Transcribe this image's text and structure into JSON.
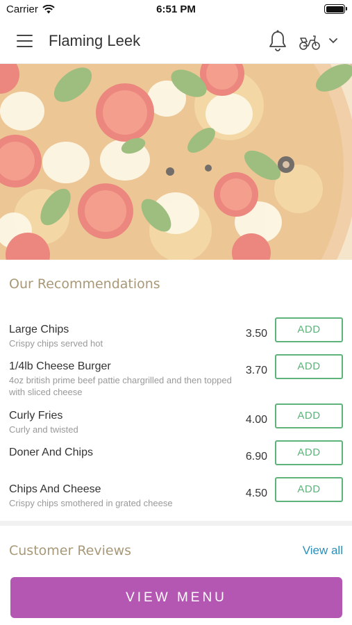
{
  "status_bar": {
    "carrier": "Carrier",
    "time": "6:51 PM"
  },
  "header": {
    "title": "Flaming Leek"
  },
  "icons": {
    "menu": "hamburger-icon",
    "notifications": "bell-icon",
    "delivery": "scooter-icon",
    "dropdown": "chevron-down-icon"
  },
  "recommendations": {
    "title": "Our Recommendations",
    "items": [
      {
        "name": "Large Chips",
        "description": "Crispy chips served hot",
        "price": "3.50",
        "action": "ADD"
      },
      {
        "name": "1/4lb Cheese Burger",
        "description": "4oz british prime beef pattie chargrilled and then topped with sliced cheese",
        "price": "3.70",
        "action": "ADD"
      },
      {
        "name": "Curly Fries",
        "description": "Curly and twisted",
        "price": "4.00",
        "action": "ADD"
      },
      {
        "name": "Doner And Chips",
        "description": "",
        "price": "6.90",
        "action": "ADD"
      },
      {
        "name": "Chips And Cheese",
        "description": "Crispy chips smothered in grated cheese",
        "price": "4.50",
        "action": "ADD"
      }
    ]
  },
  "reviews": {
    "title": "Customer Reviews",
    "view_all": "View all"
  },
  "cta": {
    "label": "VIEW MENU"
  },
  "colors": {
    "accent": "#b457b3",
    "add_green": "#5db37a",
    "link_blue": "#2c8fb8",
    "section_title": "#a89878"
  }
}
